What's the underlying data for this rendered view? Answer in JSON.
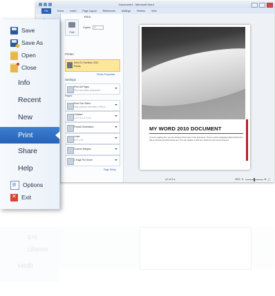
{
  "window": {
    "title": "Document1 - Microsoft Word",
    "tabs": [
      "File",
      "Home",
      "Insert",
      "Page Layout",
      "References",
      "Mailings",
      "Review",
      "View"
    ]
  },
  "window_sidebar": {
    "save": "Save"
  },
  "print_settings": {
    "print_heading": "Print",
    "copies_label": "Copies:",
    "copies_value": "1",
    "print_button": "Print",
    "printer_heading": "Printer",
    "printer_name": "Send To OneNote 2010",
    "printer_status": "Ready",
    "printer_properties": "Printer Properties",
    "settings_heading": "Settings",
    "options": [
      {
        "main": "Print All Pages",
        "sub": "Print the entire document"
      },
      {
        "main": "Print One Sided",
        "sub": "Only print on one side of the p..."
      },
      {
        "main": "Collated",
        "sub": "1,2,3   1,2,3   1,2,3"
      },
      {
        "main": "Portrait Orientation",
        "sub": ""
      },
      {
        "main": "Letter",
        "sub": "8.5\" x 11\""
      },
      {
        "main": "Custom Margins",
        "sub": ""
      },
      {
        "main": "1 Page Per Sheet",
        "sub": ""
      }
    ],
    "pages_label": "Pages:",
    "page_setup": "Page Setup"
  },
  "preview": {
    "doc_title": "MY WORD 2010 DOCUMENT",
    "doc_body": "If you're reading this, you are looking at the body of the document. This is a short paragraph placed below the title so that the preview shows text. You can replace it with the content of your own document.",
    "pager": "1   of 1",
    "zoom": "36%"
  },
  "file_menu": {
    "items": [
      {
        "label": "Save",
        "icon": "save-icon"
      },
      {
        "label": "Save As",
        "icon": "save-as-icon"
      },
      {
        "label": "Open",
        "icon": "open-folder-icon"
      },
      {
        "label": "Close",
        "icon": "close-document-icon"
      },
      {
        "label": "Info"
      },
      {
        "label": "Recent"
      },
      {
        "label": "New"
      },
      {
        "label": "Print",
        "selected": true
      },
      {
        "label": "Share"
      },
      {
        "label": "Help"
      },
      {
        "label": "Options",
        "icon": "options-icon"
      },
      {
        "label": "Exit",
        "icon": "exit-icon"
      }
    ]
  },
  "colors": {
    "accent": "#2463b8",
    "printer_highlight": "#fde79b",
    "doc_accent": "#b91f1f"
  }
}
